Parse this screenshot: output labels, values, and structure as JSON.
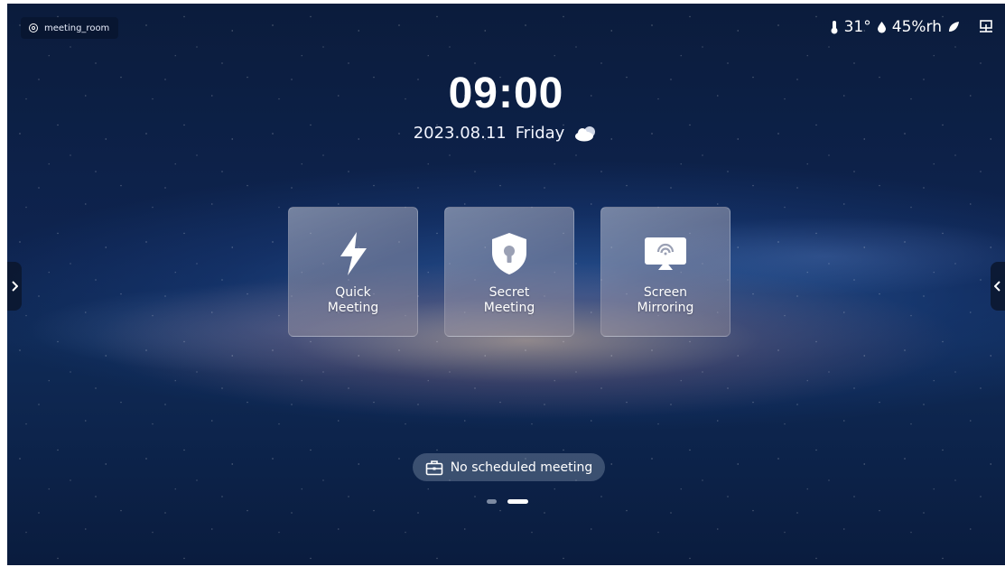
{
  "location": {
    "name": "meeting_room",
    "icon": "location-pin-icon"
  },
  "status": {
    "temperature": "31°",
    "humidity": "45%rh",
    "icons": [
      "thermometer-icon",
      "humidity-drop-icon",
      "leaf-icon",
      "network-icon"
    ]
  },
  "clock": {
    "time": "09:00",
    "date": "2023.08.11",
    "weekday": "Friday",
    "weather_icon": "cloudy-icon"
  },
  "cards": [
    {
      "label_line1": "Quick",
      "label_line2": "Meeting",
      "icon": "lightning-icon"
    },
    {
      "label_line1": "Secret",
      "label_line2": "Meeting",
      "icon": "shield-lock-icon"
    },
    {
      "label_line1": "Screen",
      "label_line2": "Mirroring",
      "icon": "screen-mirroring-icon"
    }
  ],
  "schedule": {
    "text": "No scheduled meeting",
    "icon": "briefcase-icon"
  },
  "pager": {
    "pages": 2,
    "active_index": 1
  },
  "colors": {
    "background": "#0e2450",
    "card": "#b9b8c6",
    "accent": "#ffffff"
  }
}
